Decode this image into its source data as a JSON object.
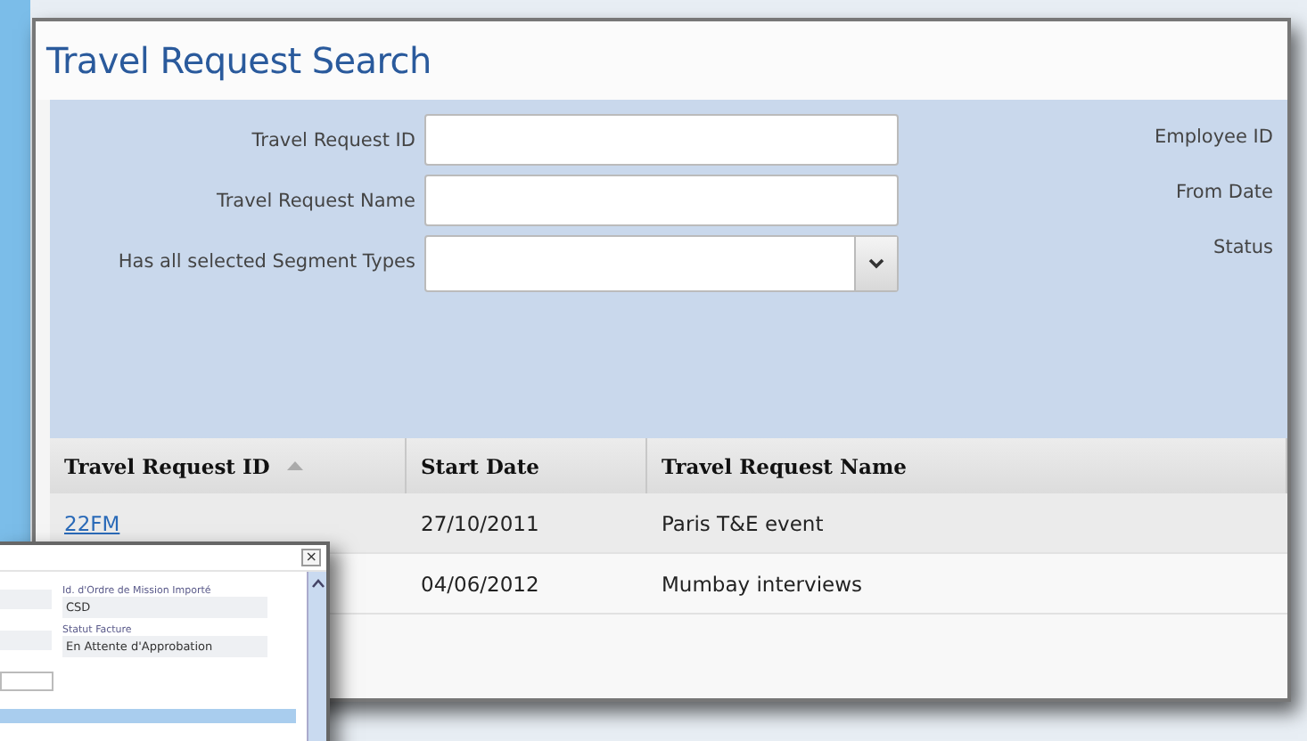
{
  "window": {
    "title": "Travel Request Search"
  },
  "search_form": {
    "fields": [
      {
        "label": "Travel Request ID",
        "kind": "text"
      },
      {
        "label": "Travel Request Name",
        "kind": "text"
      },
      {
        "label": "Has all selected Segment Types",
        "kind": "dropdown"
      }
    ],
    "right_labels": [
      "Employee ID",
      "From Date",
      "Status"
    ]
  },
  "table": {
    "columns": [
      {
        "label": "Travel Request ID",
        "sorted": true
      },
      {
        "label": "Start Date",
        "sorted": false
      },
      {
        "label": "Travel Request Name",
        "sorted": false
      }
    ],
    "rows": [
      {
        "id": "22FM",
        "start_date": "27/10/2011",
        "name": "Paris T&E event"
      },
      {
        "start_date": "04/06/2012",
        "name": "Mumbay interviews"
      }
    ]
  },
  "dialog": {
    "close": "×",
    "fields": [
      {
        "label": "Id. d'Ordre de Mission Importé",
        "value": "CSD"
      },
      {
        "label": "Statut Facture",
        "value": "En Attente d'Approbation"
      }
    ]
  }
}
